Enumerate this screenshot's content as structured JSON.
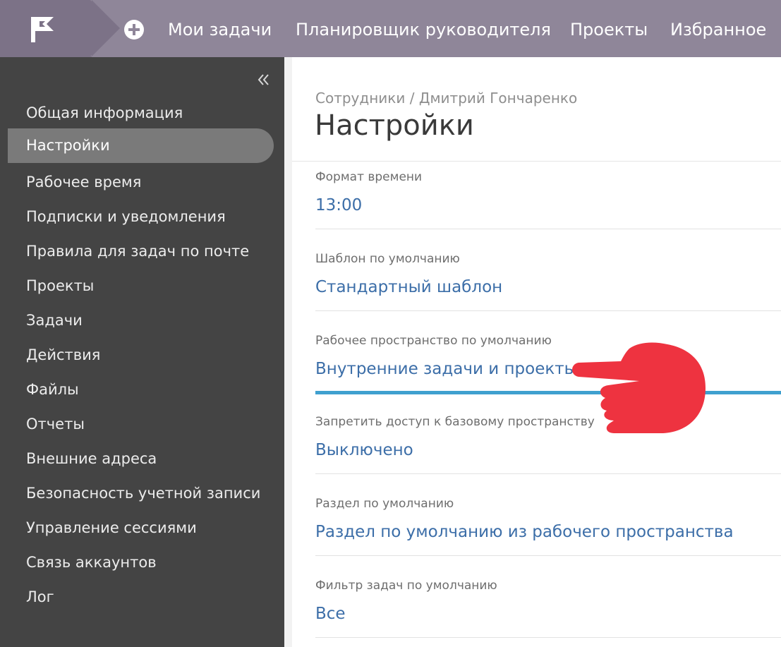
{
  "nav": {
    "items": [
      {
        "label": "Мои задачи"
      },
      {
        "label": "Планировщик руководителя"
      },
      {
        "label": "Проекты"
      },
      {
        "label": "Избранное"
      }
    ]
  },
  "sidebar": {
    "items": [
      {
        "label": "Общая информация"
      },
      {
        "label": "Настройки",
        "active": true
      },
      {
        "label": "Рабочее время"
      },
      {
        "label": "Подписки и уведомления"
      },
      {
        "label": "Правила для задач по почте"
      },
      {
        "label": "Проекты"
      },
      {
        "label": "Задачи"
      },
      {
        "label": "Действия"
      },
      {
        "label": "Файлы"
      },
      {
        "label": "Отчеты"
      },
      {
        "label": "Внешние адреса"
      },
      {
        "label": "Безопасность учетной записи"
      },
      {
        "label": "Управление сессиями"
      },
      {
        "label": "Связь аккаунтов"
      },
      {
        "label": "Лог"
      }
    ]
  },
  "breadcrumb": {
    "root": "Сотрудники",
    "separator": " / ",
    "current": "Дмитрий Гончаренко"
  },
  "page": {
    "title": "Настройки"
  },
  "settings": [
    {
      "label": "Формат времени",
      "value": "13:00"
    },
    {
      "label": "Шаблон по умолчанию",
      "value": "Стандартный шаблон"
    },
    {
      "label": "Рабочее пространство по умолчанию",
      "value": "Внутренние задачи и проекты",
      "highlighted": true
    },
    {
      "label": "Запретить доступ к базовому пространству",
      "value": "Выключено"
    },
    {
      "label": "Раздел по умолчанию",
      "value": "Раздел по умолчанию из рабочего пространства"
    },
    {
      "label": "Фильтр задач по умолчанию",
      "value": "Все"
    }
  ],
  "colors": {
    "topbar": "#8f8699",
    "logo_block": "#7c7287",
    "sidebar": "#444444",
    "sidebar_active": "#7a7a7a",
    "link": "#3c6ea8",
    "highlight_line": "#3fa0cf",
    "pointer_hand": "#ee3340"
  },
  "icons": {
    "logo": "flag-logo-icon",
    "add": "plus-circle-icon",
    "collapse": "double-chevron-left-icon",
    "pointer": "pointing-hand-icon"
  }
}
